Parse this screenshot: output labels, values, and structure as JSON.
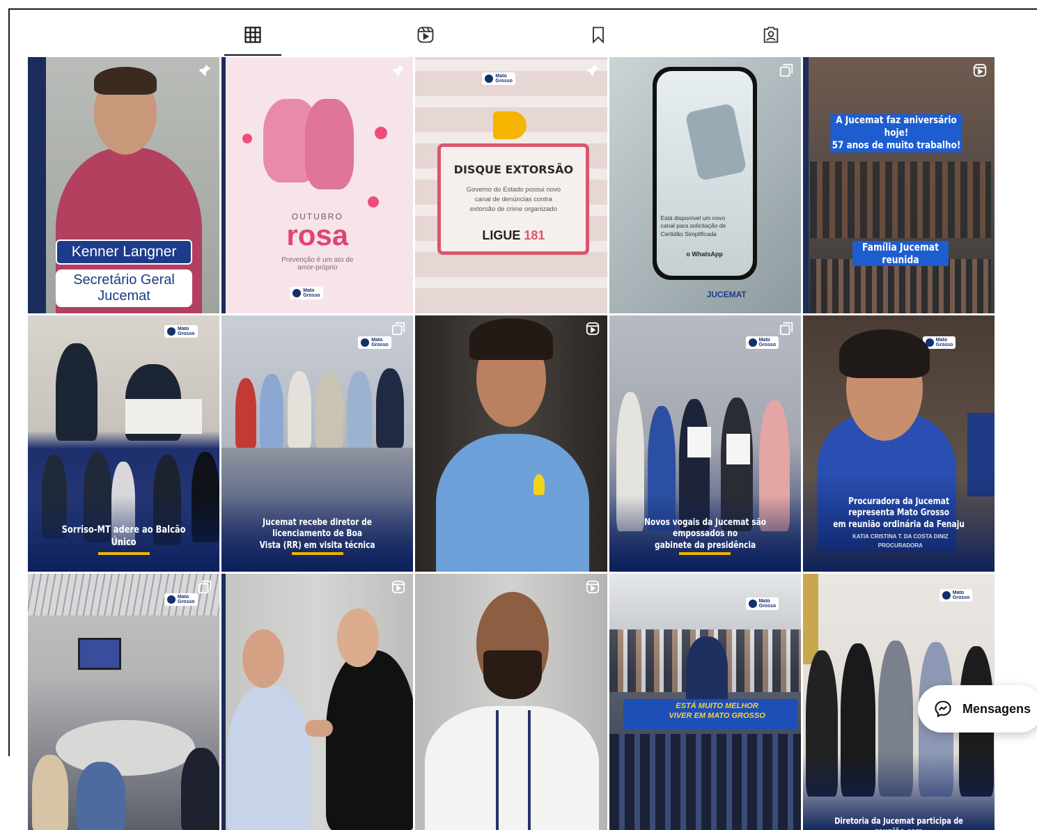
{
  "tabs": [
    {
      "name": "posts",
      "icon": "grid-icon",
      "active": true
    },
    {
      "name": "reels",
      "icon": "reels-icon",
      "active": false
    },
    {
      "name": "saved",
      "icon": "bookmark-icon",
      "active": false
    },
    {
      "name": "tagged",
      "icon": "tagged-user-icon",
      "active": false
    }
  ],
  "posts": [
    {
      "corner_icon": "pin-icon",
      "name_label": "Kenner Langner",
      "role_label": "Secretário Geral\nJucemat"
    },
    {
      "corner_icon": "pin-icon",
      "title_top": "OUTUBRO",
      "title_main": "rosa",
      "subtitle": "Prevenção é um ato de\namor-próprio"
    },
    {
      "corner_icon": "pin-icon",
      "heading": "DISQUE EXTORSÃO",
      "body": "Governo do Estado possui novo\ncanal de denúncias contra\nextorsão de crime organizado",
      "cta_prefix": "LIGUE ",
      "cta_number": "181"
    },
    {
      "corner_icon": "carousel-icon",
      "phone_text": "Está disponível um novo\ncanal para solicitação de\nCertidão Simplificada",
      "phone_cta": "o WhatsApp",
      "footer_logo": "JUCEMAT"
    },
    {
      "corner_icon": "reels-icon",
      "banner_top": "A Jucemat faz aniversário hoje!\n57 anos de muito trabalho!",
      "banner_bottom": "Família Jucemat reunida"
    },
    {
      "corner_icon": "",
      "caption": "Sorriso-MT adere ao Balcão Único"
    },
    {
      "corner_icon": "carousel-icon",
      "caption": "Jucemat recebe diretor de licenciamento de Boa\nVista (RR) em visita técnica"
    },
    {
      "corner_icon": "reels-icon",
      "caption": ""
    },
    {
      "corner_icon": "carousel-icon",
      "caption": "Novos vogais da Jucemat são empossados no\ngabinete da presidência"
    },
    {
      "corner_icon": "",
      "caption": "Procuradora da Jucemat representa Mato Grosso\nem reunião ordinária da Fenaju",
      "nameplate": "KATIA CRISTINA T. DA COSTA DINIZ\nPROCURADORA"
    },
    {
      "corner_icon": "carousel-icon",
      "caption": ""
    },
    {
      "corner_icon": "reels-icon",
      "caption": ""
    },
    {
      "corner_icon": "reels-icon",
      "caption": ""
    },
    {
      "corner_icon": "",
      "caption": "",
      "banner": "ESTÁ MUITO MELHOR\nVIVER EM MATO GROSSO"
    },
    {
      "corner_icon": "",
      "caption": "Diretoria da Jucemat participa de reunião com"
    }
  ],
  "brand": {
    "logo_text": "Mato\nGrosso",
    "accent": "#13306b",
    "rule": "#f0b400"
  },
  "messages_button": {
    "label": "Mensagens",
    "icon": "messenger-icon"
  }
}
